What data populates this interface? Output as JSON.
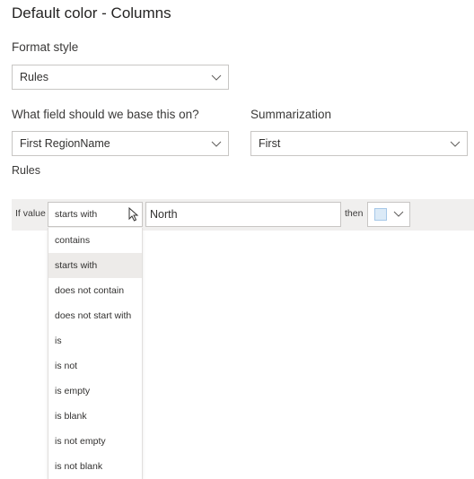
{
  "title": "Default color - Columns",
  "format_style": {
    "label": "Format style",
    "value": "Rules"
  },
  "base_field": {
    "label": "What field should we base this on?",
    "value": "First RegionName"
  },
  "summarization": {
    "label": "Summarization",
    "value": "First"
  },
  "rules": {
    "label": "Rules",
    "if_label": "If value",
    "condition": "starts with",
    "value": "North",
    "then_label": "then",
    "color": "#dbeaf7"
  },
  "condition_options": [
    {
      "label": "contains",
      "selected": false
    },
    {
      "label": "starts with",
      "selected": true
    },
    {
      "label": "does not contain",
      "selected": false
    },
    {
      "label": "does not start with",
      "selected": false
    },
    {
      "label": "is",
      "selected": false
    },
    {
      "label": "is not",
      "selected": false
    },
    {
      "label": "is empty",
      "selected": false
    },
    {
      "label": "is blank",
      "selected": false
    },
    {
      "label": "is not empty",
      "selected": false
    },
    {
      "label": "is not blank",
      "selected": false
    }
  ],
  "icons": {
    "dropdown": "chevron-down-icon",
    "cursor": "mouse-pointer-icon"
  }
}
